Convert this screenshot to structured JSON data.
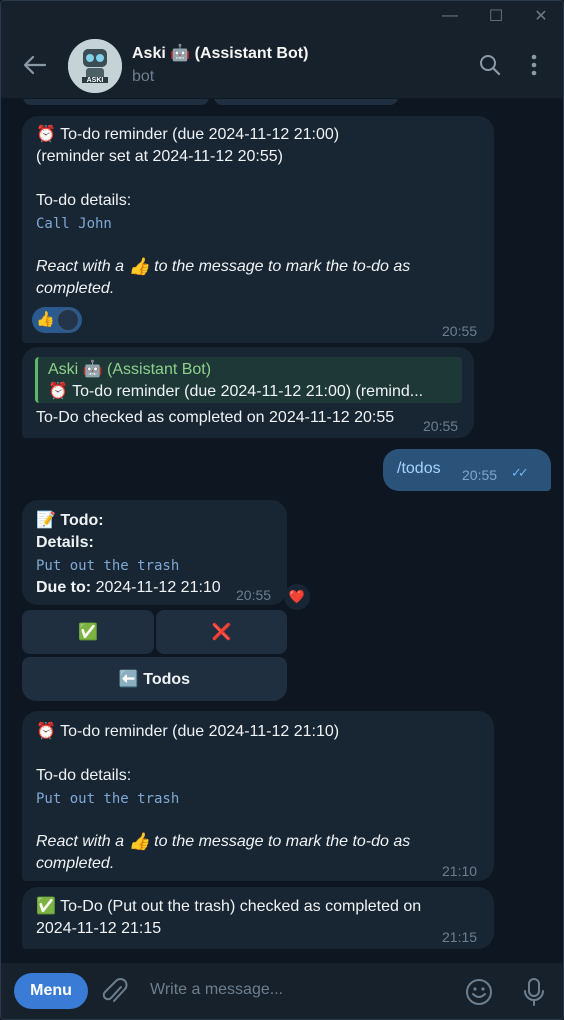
{
  "window": {
    "minimize": "—",
    "maximize": "☐",
    "close": "✕"
  },
  "header": {
    "bot_name": "Aski 🤖 (Assistant Bot)",
    "status": "bot",
    "avatar_label": "ASKI"
  },
  "messages": {
    "m1": {
      "line1": "⏰ To-do reminder (due 2024-11-12 21:00)",
      "line2": "(reminder set at 2024-11-12 20:55)",
      "details_label": "To-do details:",
      "details": "Call John",
      "react_pre": "React with a",
      "react_emoji": "👍",
      "react_post": "to the message to mark the to-do as",
      "react_post2": "completed.",
      "reaction": "👍",
      "time": "20:55"
    },
    "m2": {
      "quote_author": "Aski 🤖 (Assistant Bot)",
      "quote_text": "⏰ To-do reminder (due 2024-11-12 21:00) (remind...",
      "text": "To-Do checked as completed on 2024-11-12 20:55",
      "time": "20:55"
    },
    "m3": {
      "text": "/todos",
      "time": "20:55",
      "check": "✓✓"
    },
    "m4": {
      "title": "📝 Todo:",
      "details_label": "Details:",
      "details": "Put out the trash",
      "due_label": "Due to:",
      "due": "2024-11-12 21:10",
      "time": "20:55",
      "reaction": "❤️",
      "btn_done": "✅",
      "btn_delete": "❌",
      "btn_back": "⬅️ Todos"
    },
    "m5": {
      "line1": "⏰ To-do reminder (due 2024-11-12 21:10)",
      "details_label": "To-do details:",
      "details": "Put out the trash",
      "react_pre": "React with a",
      "react_emoji": "👍",
      "react_post": "to the message to mark the to-do as",
      "react_post2": "completed.",
      "time": "21:10"
    },
    "m6": {
      "line1": "✅ To-Do (Put out the trash) checked as completed on",
      "line2": "2024-11-12 21:15",
      "time": "21:15"
    }
  },
  "input": {
    "menu_label": "Menu",
    "placeholder": "Write a message..."
  },
  "colors": {
    "background": "#0e1621",
    "incoming": "#182533",
    "outgoing": "#2b5278",
    "accent": "#3a7bd5",
    "code": "#7fa9d4",
    "quote_author": "#8fd18a"
  }
}
